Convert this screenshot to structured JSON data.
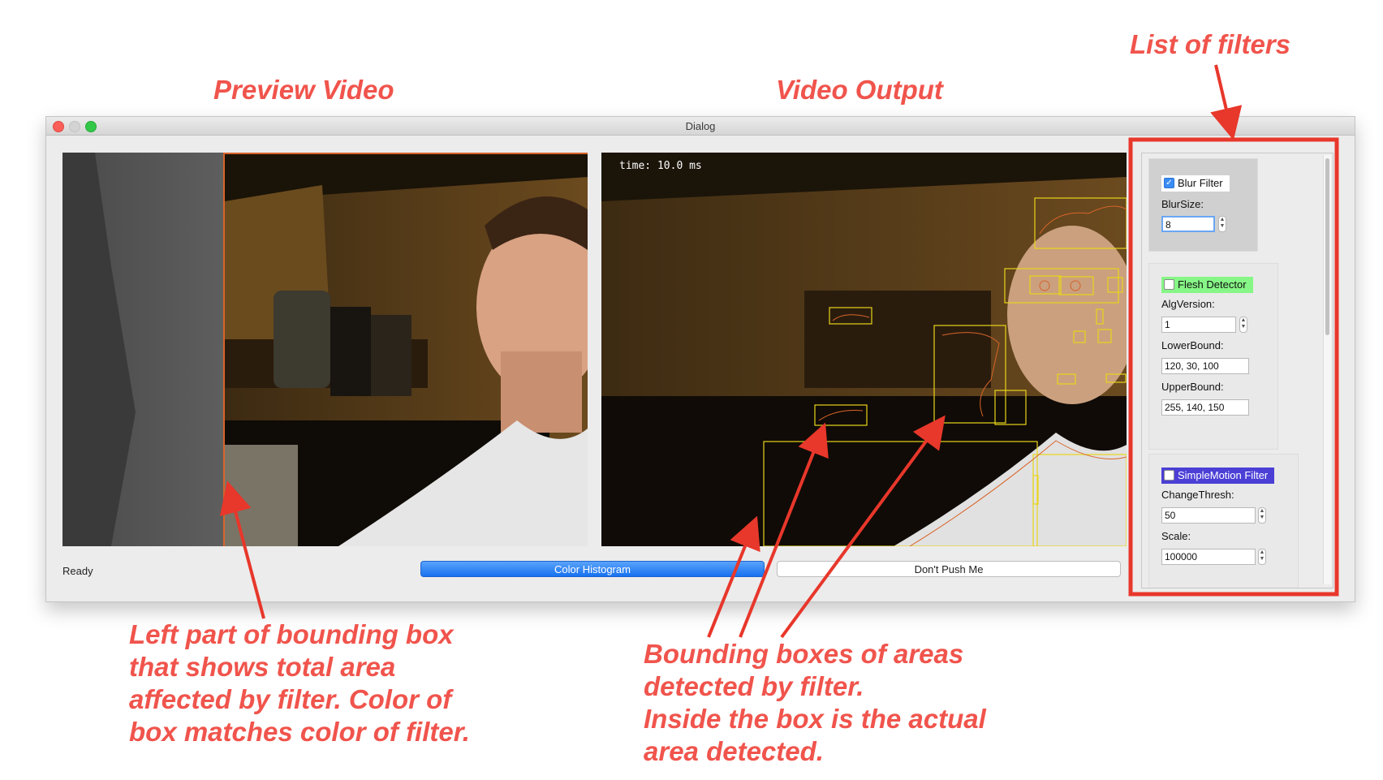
{
  "annotations": {
    "list_of_filters": "List of filters",
    "preview_video": "Preview Video",
    "video_output": "Video Output",
    "left_caption": [
      "Left part of bounding box",
      "that shows total area",
      "affected by filter.  Color of",
      "box matches color of filter."
    ],
    "right_caption": [
      "Bounding boxes of areas",
      "detected by filter.",
      "Inside the box is the actual",
      "area detected."
    ],
    "color": "#f0544c"
  },
  "window": {
    "title": "Dialog",
    "timing_text": "time: 10.0 ms",
    "status": "Ready",
    "buttons": {
      "color_histogram": "Color Histogram",
      "dont_push": "Don't Push Me"
    }
  },
  "filters": [
    {
      "name": "Blur Filter",
      "checked": true,
      "color": "#ffffff",
      "params": [
        {
          "label": "BlurSize:",
          "value": "8"
        }
      ]
    },
    {
      "name": "Flesh Detector",
      "checked": false,
      "color": "#86f786",
      "params": [
        {
          "label": "AlgVersion:",
          "value": "1"
        },
        {
          "label": "LowerBound:",
          "value": "120, 30, 100"
        },
        {
          "label": "UpperBound:",
          "value": "255, 140, 150"
        }
      ]
    },
    {
      "name": "SimpleMotion Filter",
      "checked": false,
      "color": "#4b3fd6",
      "params": [
        {
          "label": "ChangeThresh:",
          "value": "50"
        },
        {
          "label": "Scale:",
          "value": "100000"
        }
      ]
    }
  ],
  "colors": {
    "detection_box": "#e8d41a",
    "preview_bbox_edge": "#d8642a",
    "highlight_frame": "#e8372b",
    "primary_button": "#1771f0"
  }
}
